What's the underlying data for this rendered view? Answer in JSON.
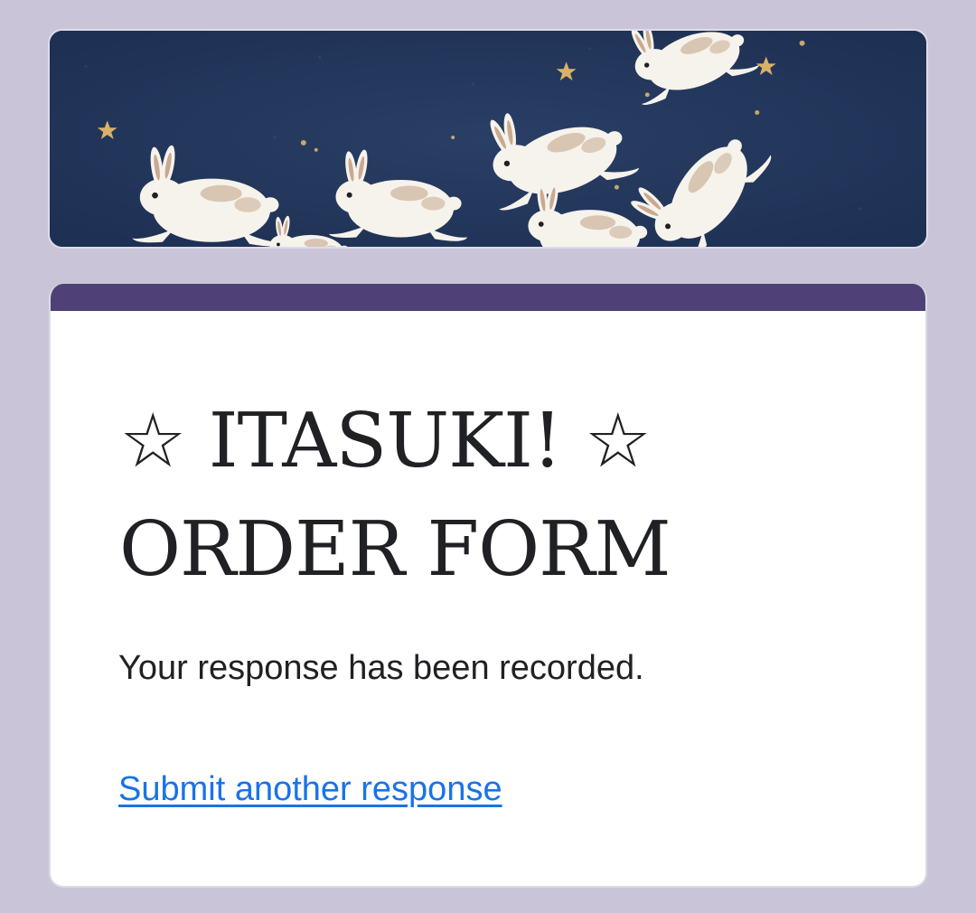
{
  "header": {
    "banner_image": "night-sky-rabbits-banner",
    "accent_color": "#4f4177"
  },
  "form": {
    "title_line1": "☆ ITASUKI! ☆",
    "title_line2": "ORDER FORM",
    "confirmation_message": "Your response has been recorded.",
    "submit_another_label": "Submit another response"
  },
  "colors": {
    "page_background": "#c9c4d8",
    "link": "#1a73e8",
    "banner_background": "#213458"
  }
}
